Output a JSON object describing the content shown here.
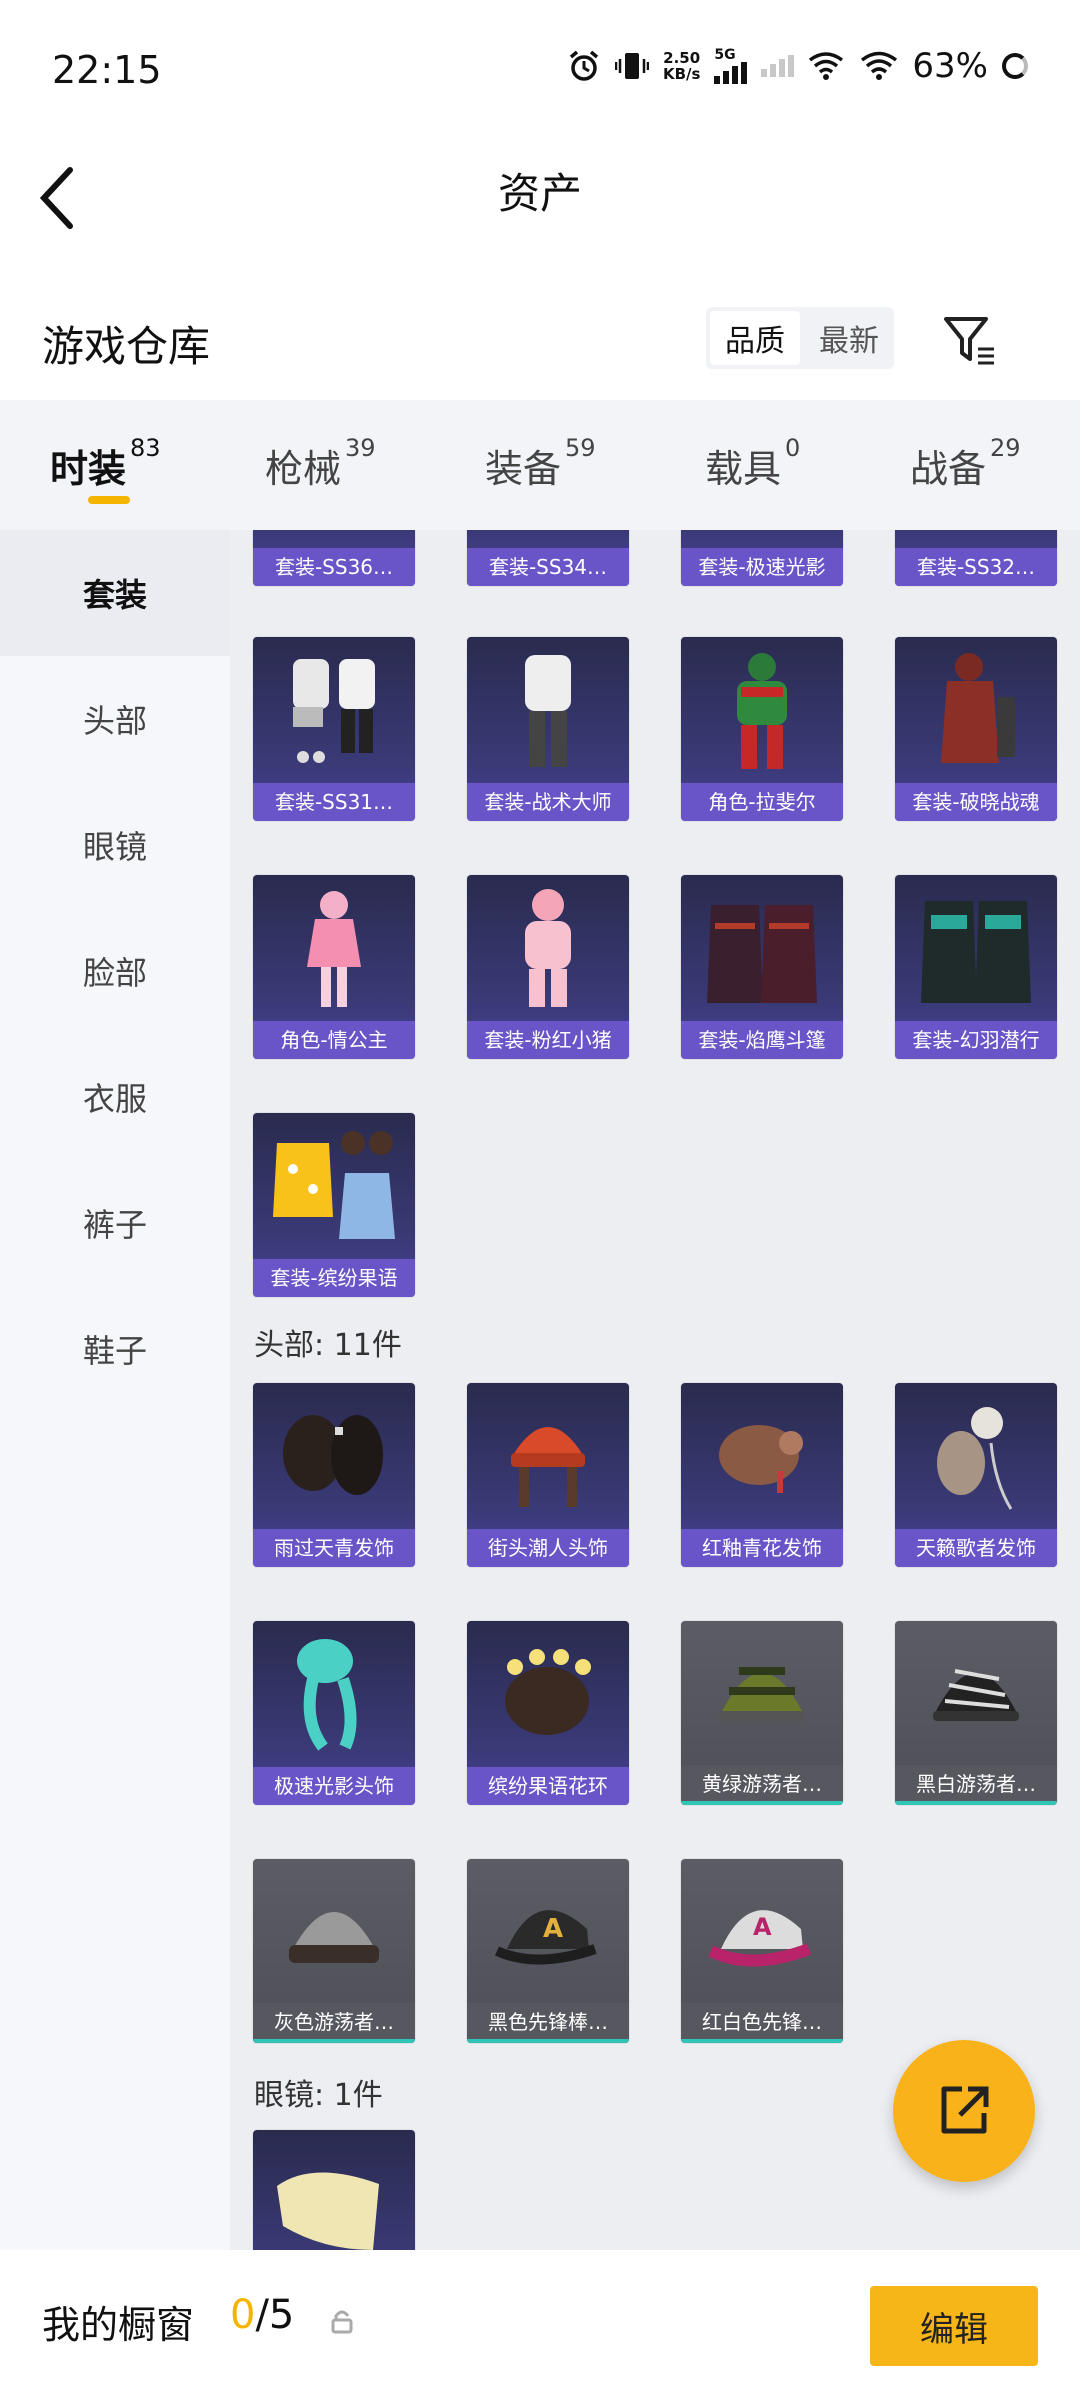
{
  "status": {
    "time": "22:15",
    "net_speed": "2.50",
    "net_unit": "KB/s",
    "network": "5G",
    "battery": "63%"
  },
  "nav": {
    "title": "资产"
  },
  "warehouse": {
    "title": "游戏仓库",
    "sort_quality": "品质",
    "sort_newest": "最新"
  },
  "tabs": [
    {
      "label": "时装",
      "count": "83"
    },
    {
      "label": "枪械",
      "count": "39"
    },
    {
      "label": "装备",
      "count": "59"
    },
    {
      "label": "载具",
      "count": "0"
    },
    {
      "label": "战备",
      "count": "29"
    }
  ],
  "sidebar": [
    "套装",
    "头部",
    "眼镜",
    "脸部",
    "衣服",
    "裤子",
    "鞋子"
  ],
  "suits_partial": [
    "套装-SS36…",
    "套装-SS34…",
    "套装-极速光影",
    "套装-SS32…"
  ],
  "suits": [
    "套装-SS31…",
    "套装-战术大师",
    "角色-拉斐尔",
    "套装-破晓战魂",
    "角色-情公主",
    "套装-粉红小猪",
    "套装-焰鹰斗篷",
    "套装-幻羽潜行",
    "套装-缤纷果语"
  ],
  "head_section": "头部: 11件",
  "head_items": [
    "雨过天青发饰",
    "街头潮人头饰",
    "红釉青花发饰",
    "天籁歌者发饰",
    "极速光影头饰",
    "缤纷果语花环",
    "黄绿游荡者…",
    "黑白游荡者…",
    "灰色游荡者…",
    "黑色先锋棒…",
    "红白色先锋…"
  ],
  "glasses_section": "眼镜: 1件",
  "bottom": {
    "label": "我的橱窗",
    "current": "0",
    "total": "/5",
    "edit": "编辑"
  }
}
